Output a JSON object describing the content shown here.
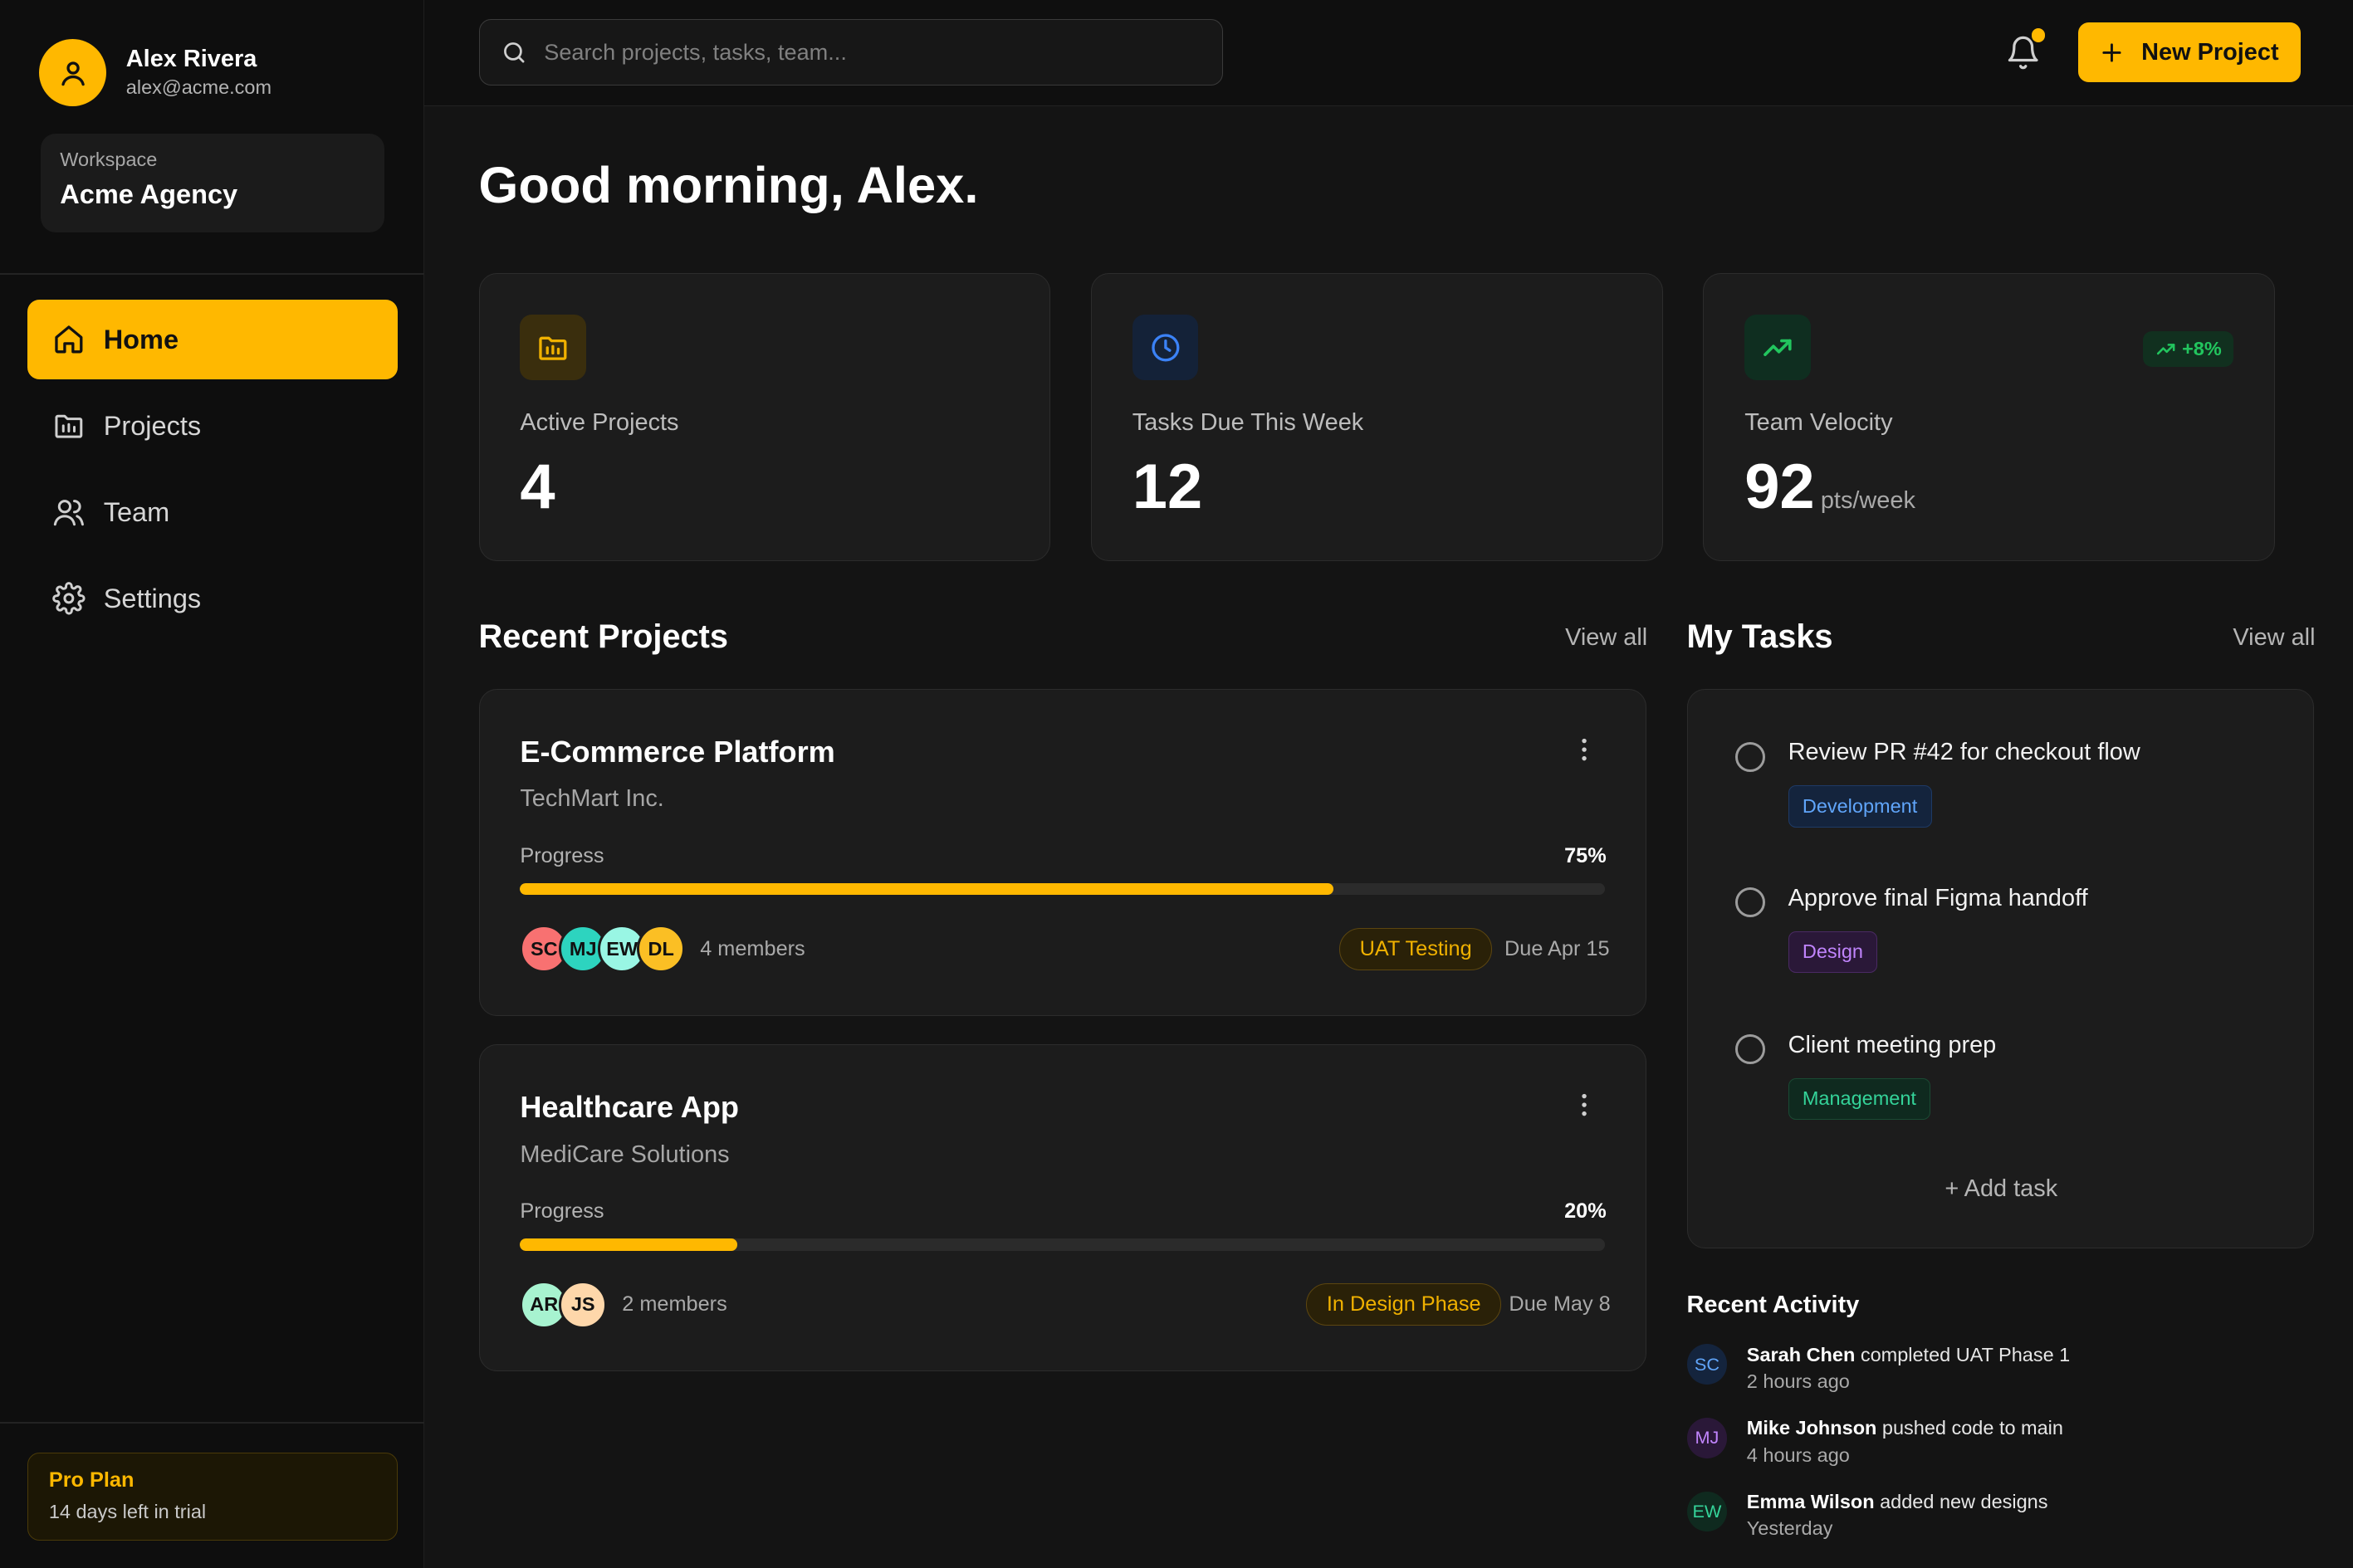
{
  "user": {
    "name": "Alex Rivera",
    "email": "alex@acme.com"
  },
  "workspace": {
    "label": "Workspace",
    "name": "Acme Agency"
  },
  "nav": [
    {
      "label": "Home",
      "icon": "home-icon",
      "active": true
    },
    {
      "label": "Projects",
      "icon": "folder-icon",
      "active": false
    },
    {
      "label": "Team",
      "icon": "users-icon",
      "active": false
    },
    {
      "label": "Settings",
      "icon": "gear-icon",
      "active": false
    }
  ],
  "plan": {
    "title": "Pro Plan",
    "subtitle": "14 days left in trial"
  },
  "search": {
    "placeholder": "Search projects, tasks, team..."
  },
  "header": {
    "new_project_label": "New Project"
  },
  "greeting": "Good morning, Alex.",
  "stats": [
    {
      "label": "Active Projects",
      "value": "4",
      "icon": "folder-chart-icon",
      "color": "#f0b100"
    },
    {
      "label": "Tasks Due This Week",
      "value": "12",
      "icon": "clock-icon",
      "color": "#3b82f6"
    },
    {
      "label": "Team Velocity",
      "value": "92",
      "unit": "pts/week",
      "trend": "+8%",
      "icon": "trending-up-icon",
      "color": "#22c55e"
    }
  ],
  "recent_projects": {
    "title": "Recent Projects",
    "view_all": "View all",
    "progress_label": "Progress",
    "items": [
      {
        "name": "E-Commerce Platform",
        "client": "TechMart Inc.",
        "progress": "75%",
        "progress_value": 75,
        "members": [
          {
            "initials": "SC",
            "color": "#f87171"
          },
          {
            "initials": "MJ",
            "color": "#2dd4bf"
          },
          {
            "initials": "EW",
            "color": "#99f6e4"
          },
          {
            "initials": "DL",
            "color": "#fbbf24"
          }
        ],
        "members_label": "4 members",
        "status": "UAT Testing",
        "due": "Due Apr 15"
      },
      {
        "name": "Healthcare App",
        "client": "MediCare Solutions",
        "progress": "20%",
        "progress_value": 20,
        "members": [
          {
            "initials": "AR",
            "color": "#a7f3d0"
          },
          {
            "initials": "JS",
            "color": "#fed7aa"
          }
        ],
        "members_label": "2 members",
        "status": "In Design Phase",
        "due": "Due May 8"
      }
    ]
  },
  "my_tasks": {
    "title": "My Tasks",
    "view_all": "View all",
    "items": [
      {
        "title": "Review PR #42 for checkout flow",
        "tag": "Development",
        "tag_color": "#60a5fa"
      },
      {
        "title": "Approve final Figma handoff",
        "tag": "Design",
        "tag_color": "#c084fc"
      },
      {
        "title": "Client meeting prep",
        "tag": "Management",
        "tag_color": "#34d399"
      }
    ],
    "add_task": "+ Add task"
  },
  "activity": {
    "title": "Recent Activity",
    "items": [
      {
        "initials": "SC",
        "name": "Sarah Chen",
        "action": "completed UAT Phase 1",
        "time": "2 hours ago",
        "color": "#60a5fa"
      },
      {
        "initials": "MJ",
        "name": "Mike Johnson",
        "action": "pushed code to main",
        "time": "4 hours ago",
        "color": "#c084fc"
      },
      {
        "initials": "EW",
        "name": "Emma Wilson",
        "action": "added new designs",
        "time": "Yesterday",
        "color": "#34d399"
      }
    ]
  }
}
